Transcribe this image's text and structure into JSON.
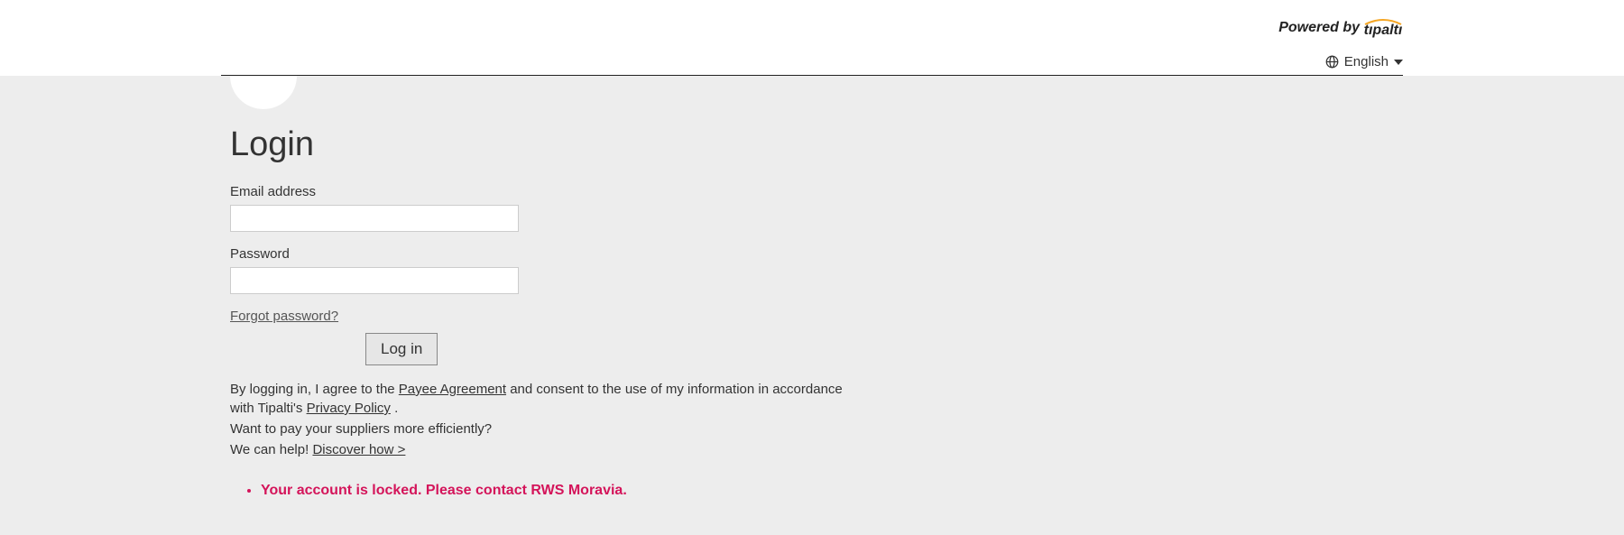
{
  "header": {
    "powered_by": "Powered by",
    "brand": "tıpaltı",
    "language": "English"
  },
  "login": {
    "title": "Login",
    "email_label": "Email address",
    "password_label": "Password",
    "forgot_link": "Forgot password?",
    "login_button": "Log in"
  },
  "legal": {
    "prefix": "By logging in, I agree to the ",
    "payee_agreement": "Payee Agreement",
    "middle": " and consent to the use of my information in accordance with Tipalti's ",
    "privacy_policy": "Privacy Policy",
    "suffix": " .",
    "suppliers_line": "Want to pay your suppliers more efficiently?",
    "help_prefix": "We can help! ",
    "discover_link": "Discover how >"
  },
  "error": {
    "locked_msg": "Your account is locked. Please contact RWS Moravia."
  }
}
